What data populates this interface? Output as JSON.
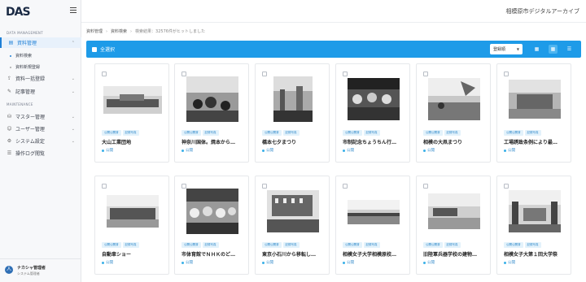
{
  "app": {
    "logo_text": "DAS",
    "title": "相模原市デジタルアーカイブ"
  },
  "sidebar": {
    "section_data": "DATA MANAGEMENT",
    "section_maint": "MAINTENANCE",
    "items": [
      {
        "label": "資料管理",
        "icon": "file-icon"
      },
      {
        "label": "資料一括登録",
        "icon": "upload-icon"
      },
      {
        "label": "記事管理",
        "icon": "edit-icon"
      },
      {
        "label": "マスター管理",
        "icon": "database-icon"
      },
      {
        "label": "ユーザー管理",
        "icon": "users-icon"
      },
      {
        "label": "システム設定",
        "icon": "gear-icon"
      },
      {
        "label": "操作ログ閲覧",
        "icon": "log-icon"
      }
    ],
    "sub_items": [
      {
        "label": "資料検索"
      },
      {
        "label": "資料新規登録"
      }
    ]
  },
  "user": {
    "name": "ナカシャ管理者",
    "role": "システム管理者",
    "avatar_text": "人"
  },
  "breadcrumb": {
    "item1": "資料管理",
    "item2": "資料検索",
    "current": "検索結果：32576件がヒットしました",
    "sep": "›"
  },
  "toolbar": {
    "select_all": "全選択",
    "sort_value": "登録順",
    "accent": "#1e9be8"
  },
  "cards": [
    {
      "title": "大山工業団地",
      "tags": [
        "公開公開済",
        "記録写真"
      ],
      "status": "公開"
    },
    {
      "title": "神奈川国体。焼本から…",
      "tags": [
        "公開公開済",
        "記録写真"
      ],
      "status": "公開"
    },
    {
      "title": "橋本七夕まつり",
      "tags": [
        "公開公開済",
        "記録写真"
      ],
      "status": "公開"
    },
    {
      "title": "市制記念ちょうちん行…",
      "tags": [
        "公開公開済",
        "記録写真"
      ],
      "status": "公開"
    },
    {
      "title": "相模の大凧まつり",
      "tags": [
        "公開公開済",
        "記録写真"
      ],
      "status": "公開"
    },
    {
      "title": "工場誘致条例により最…",
      "tags": [
        "公開公開済",
        "記録写真"
      ],
      "status": "公開"
    },
    {
      "title": "自動車ショー",
      "tags": [
        "公開公開済",
        "記録写真"
      ],
      "status": "公開"
    },
    {
      "title": "市体育館でＮＨＫのど…",
      "tags": [
        "公開公開済",
        "記録写真"
      ],
      "status": "公開"
    },
    {
      "title": "東京小石川から移転し…",
      "tags": [
        "公開公開済",
        "記録写真"
      ],
      "status": "公開"
    },
    {
      "title": "相模女子大学相模原校…",
      "tags": [
        "公開公開済",
        "記録写真"
      ],
      "status": "公開"
    },
    {
      "title": "旧陸軍兵器学校の建物…",
      "tags": [
        "公開公開済",
        "記録写真"
      ],
      "status": "公開"
    },
    {
      "title": "相模女子大第１回大学祭",
      "tags": [
        "公開公開済",
        "記録写真"
      ],
      "status": "公開"
    }
  ]
}
